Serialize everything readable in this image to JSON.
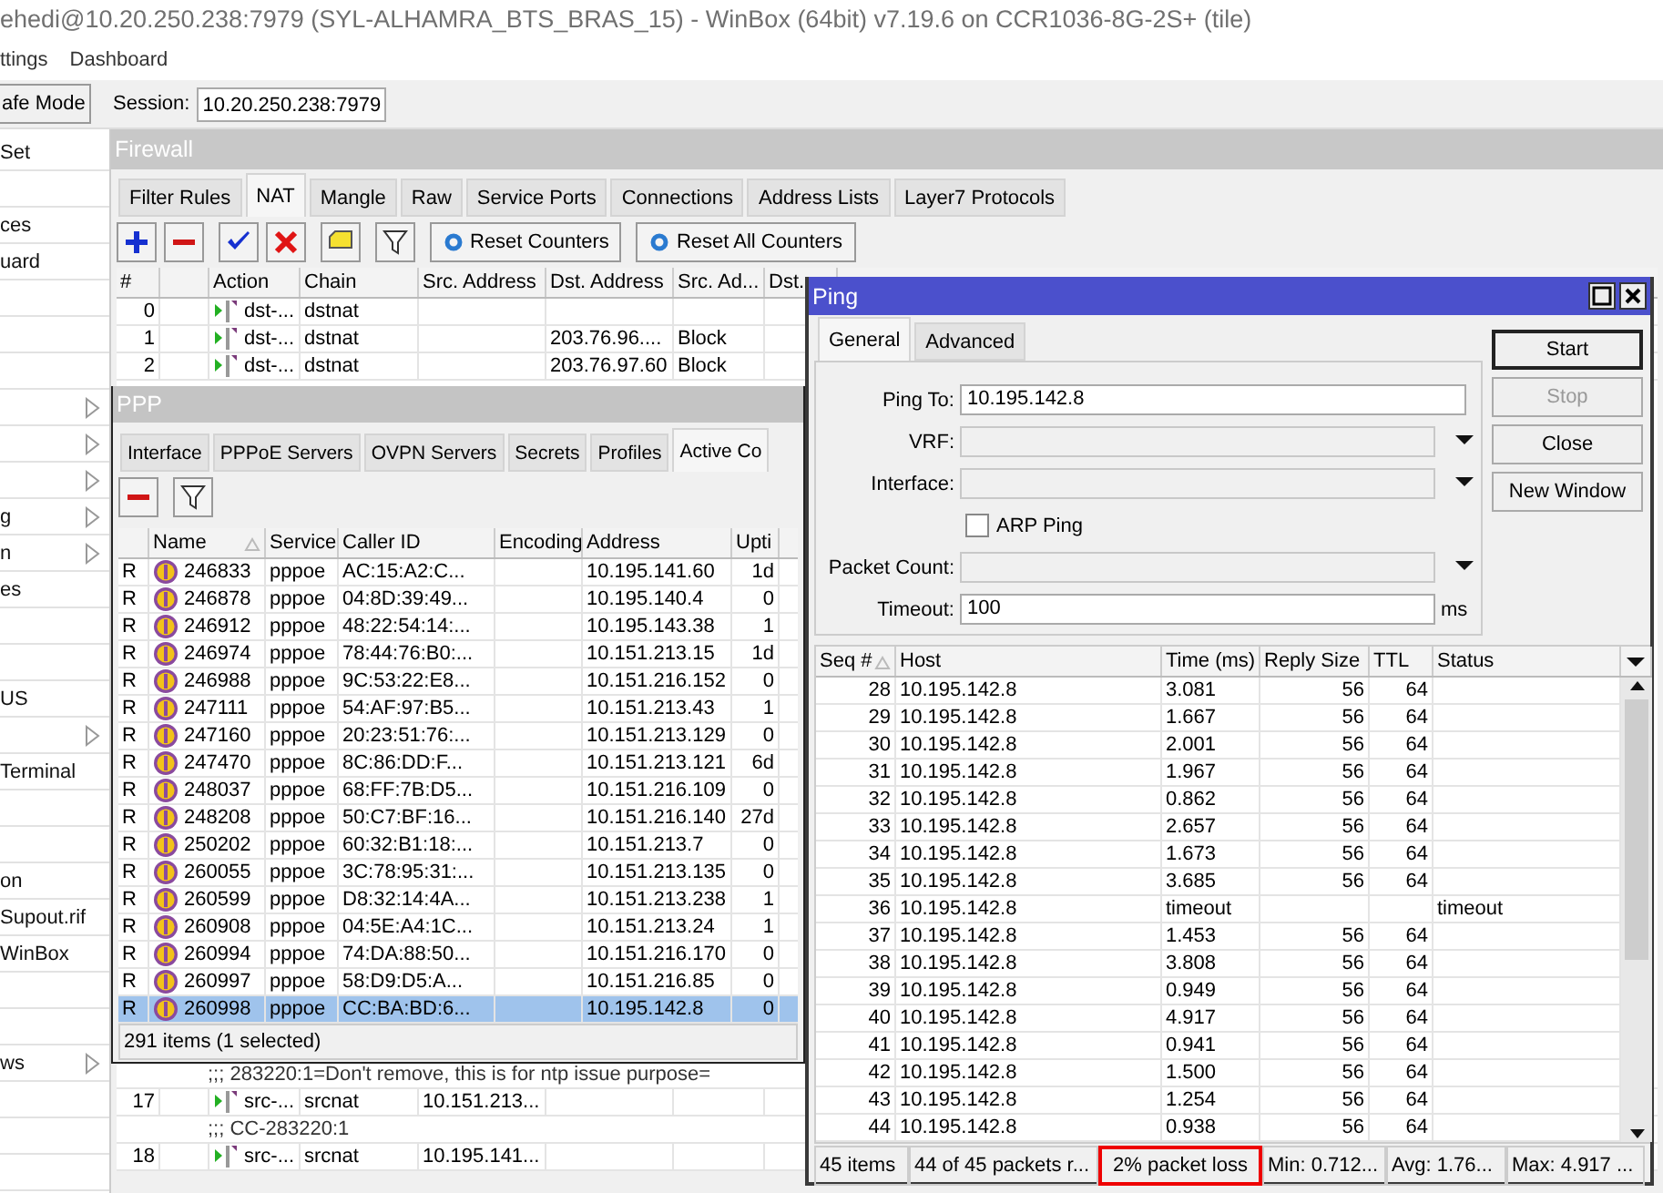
{
  "window": {
    "title": "ehedi@10.20.250.238:7979 (SYL-ALHAMRA_BTS_BRAS_15) - WinBox (64bit) v7.19.6 on CCR1036-8G-2S+ (tile)"
  },
  "menu": [
    "ttings",
    "Dashboard"
  ],
  "toolbar": {
    "safe_mode": "afe Mode",
    "session_label": "Session:",
    "session": "10.20.250.238:7979"
  },
  "sidebar": {
    "items": [
      {
        "label": "Set",
        "submenu": false
      },
      {
        "submenu": false
      },
      {
        "label": "ces",
        "submenu": false
      },
      {
        "label": "uard",
        "submenu": false
      },
      {
        "submenu": false
      },
      {
        "submenu": false
      },
      {
        "submenu": false
      },
      {
        "submenu": true
      },
      {
        "submenu": true
      },
      {
        "submenu": true
      },
      {
        "label": "g",
        "submenu": true
      },
      {
        "label": "n",
        "submenu": true
      },
      {
        "label": "es",
        "submenu": false
      },
      {
        "submenu": false
      },
      {
        "submenu": false
      },
      {
        "label": "US",
        "submenu": false
      },
      {
        "submenu": true
      },
      {
        "label": "Terminal",
        "submenu": false
      },
      {
        "submenu": false
      },
      {
        "submenu": false
      },
      {
        "label": "on",
        "submenu": false
      },
      {
        "label": "Supout.rif",
        "submenu": false
      },
      {
        "label": "WinBox",
        "submenu": false
      },
      {
        "submenu": false
      },
      {
        "submenu": false
      },
      {
        "label": "ws",
        "submenu": true
      },
      {
        "submenu": false
      },
      {
        "submenu": false
      },
      {
        "submenu": false
      }
    ]
  },
  "firewall": {
    "title": "Firewall",
    "tabs": [
      {
        "label": "Filter Rules",
        "selected": false
      },
      {
        "label": "NAT",
        "selected": true
      },
      {
        "label": "Mangle",
        "selected": false
      },
      {
        "label": "Raw",
        "selected": false
      },
      {
        "label": "Service Ports",
        "selected": false
      },
      {
        "label": "Connections",
        "selected": false
      },
      {
        "label": "Address Lists",
        "selected": false
      },
      {
        "label": "Layer7 Protocols",
        "selected": false
      }
    ],
    "buttons": [
      "Reset Counters",
      "Reset All Counters"
    ],
    "columns": [
      "#",
      "Action",
      "Chain",
      "Src. Address",
      "Dst. Address",
      "Src. Ad...",
      "Dst."
    ],
    "rows_top": [
      {
        "kind": "rule",
        "number": "0",
        "action": "dst-...",
        "chain": "dstnat"
      },
      {
        "kind": "rule",
        "number": "1",
        "action": "dst-...",
        "chain": "dstnat",
        "dst_address": "203.76.96....",
        "src_address_list": "Block"
      },
      {
        "kind": "rule",
        "number": "2",
        "action": "dst-...",
        "chain": "dstnat",
        "dst_address": "203.76.97.60",
        "src_address_list": "Block"
      }
    ],
    "rows_bottom": [
      {
        "kind": "comment",
        "text": ";;; 283220:1=Don't remove, this is for ntp issue purpose="
      },
      {
        "kind": "rule",
        "number": "17",
        "action": "src-...",
        "chain": "srcnat",
        "src_address": "10.151.213..."
      },
      {
        "kind": "comment",
        "text": ";;; CC-283220:1"
      },
      {
        "kind": "rule",
        "number": "18",
        "action": "src-...",
        "chain": "srcnat",
        "src_address": "10.195.141..."
      }
    ]
  },
  "ppp": {
    "title": "PPP",
    "tabs": [
      {
        "label": "Interface",
        "selected": false
      },
      {
        "label": "PPPoE Servers",
        "selected": false
      },
      {
        "label": "OVPN Servers",
        "selected": false
      },
      {
        "label": "Secrets",
        "selected": false
      },
      {
        "label": "Profiles",
        "selected": false
      },
      {
        "label": "Active Co",
        "selected": true
      }
    ],
    "columns": [
      "Name",
      "Service",
      "Caller ID",
      "Encoding",
      "Address",
      "Upti"
    ],
    "rows": [
      {
        "flag": "R",
        "name": "246833",
        "service": "pppoe",
        "caller_id": "AC:15:A2:C...",
        "address": "10.195.141.60",
        "uptime": "1d",
        "selected": false
      },
      {
        "flag": "R",
        "name": "246878",
        "service": "pppoe",
        "caller_id": "04:8D:39:49...",
        "address": "10.195.140.4",
        "uptime": "0",
        "selected": false
      },
      {
        "flag": "R",
        "name": "246912",
        "service": "pppoe",
        "caller_id": "48:22:54:14:...",
        "address": "10.195.143.38",
        "uptime": "1",
        "selected": false
      },
      {
        "flag": "R",
        "name": "246974",
        "service": "pppoe",
        "caller_id": "78:44:76:B0:...",
        "address": "10.151.213.15",
        "uptime": "1d",
        "selected": false
      },
      {
        "flag": "R",
        "name": "246988",
        "service": "pppoe",
        "caller_id": "9C:53:22:E8...",
        "address": "10.151.216.152",
        "uptime": "0",
        "selected": false
      },
      {
        "flag": "R",
        "name": "247111",
        "service": "pppoe",
        "caller_id": "54:AF:97:B5...",
        "address": "10.151.213.43",
        "uptime": "1",
        "selected": false
      },
      {
        "flag": "R",
        "name": "247160",
        "service": "pppoe",
        "caller_id": "20:23:51:76:...",
        "address": "10.151.213.129",
        "uptime": "0",
        "selected": false
      },
      {
        "flag": "R",
        "name": "247470",
        "service": "pppoe",
        "caller_id": "8C:86:DD:F...",
        "address": "10.151.213.121",
        "uptime": "6d",
        "selected": false
      },
      {
        "flag": "R",
        "name": "248037",
        "service": "pppoe",
        "caller_id": "68:FF:7B:D5...",
        "address": "10.151.216.109",
        "uptime": "0",
        "selected": false
      },
      {
        "flag": "R",
        "name": "248208",
        "service": "pppoe",
        "caller_id": "50:C7:BF:16...",
        "address": "10.151.216.140",
        "uptime": "27d",
        "selected": false
      },
      {
        "flag": "R",
        "name": "250202",
        "service": "pppoe",
        "caller_id": "60:32:B1:18:...",
        "address": "10.151.213.7",
        "uptime": "0",
        "selected": false
      },
      {
        "flag": "R",
        "name": "260055",
        "service": "pppoe",
        "caller_id": "3C:78:95:31:...",
        "address": "10.151.213.135",
        "uptime": "0",
        "selected": false
      },
      {
        "flag": "R",
        "name": "260599",
        "service": "pppoe",
        "caller_id": "D8:32:14:4A...",
        "address": "10.151.213.238",
        "uptime": "1",
        "selected": false
      },
      {
        "flag": "R",
        "name": "260908",
        "service": "pppoe",
        "caller_id": "04:5E:A4:1C...",
        "address": "10.151.213.24",
        "uptime": "1",
        "selected": false
      },
      {
        "flag": "R",
        "name": "260994",
        "service": "pppoe",
        "caller_id": "74:DA:88:50...",
        "address": "10.151.216.170",
        "uptime": "0",
        "selected": false
      },
      {
        "flag": "R",
        "name": "260997",
        "service": "pppoe",
        "caller_id": "58:D9:D5:A...",
        "address": "10.151.216.85",
        "uptime": "0",
        "selected": false
      },
      {
        "flag": "R",
        "name": "260998",
        "service": "pppoe",
        "caller_id": "CC:BA:BD:6...",
        "address": "10.195.142.8",
        "uptime": "0",
        "selected": true
      }
    ],
    "status": "291 items (1 selected)"
  },
  "ping": {
    "title": "Ping",
    "tabs": [
      {
        "label": "General",
        "selected": true
      },
      {
        "label": "Advanced",
        "selected": false
      }
    ],
    "fields": [
      {
        "kind": "text",
        "label": "Ping To:",
        "value": "10.195.142.8"
      },
      {
        "kind": "select",
        "label": "VRF:",
        "disabled": true
      },
      {
        "kind": "select",
        "label": "Interface:",
        "disabled": true
      },
      {
        "kind": "checkbox",
        "label": "ARP Ping",
        "checked": false
      },
      {
        "kind": "select",
        "label": "Packet Count:",
        "disabled": true
      },
      {
        "kind": "unit",
        "label": "Timeout:",
        "value": "100",
        "unit": "ms"
      }
    ],
    "buttons": [
      {
        "label": "Start",
        "default": true,
        "disabled": false
      },
      {
        "label": "Stop",
        "default": false,
        "disabled": true
      },
      {
        "label": "Close",
        "default": false,
        "disabled": false
      },
      {
        "label": "New Window",
        "default": false,
        "disabled": false
      }
    ],
    "columns": [
      "Seq #",
      "Host",
      "Time (ms)",
      "Reply Size",
      "TTL",
      "Status"
    ],
    "rows": [
      {
        "seq": "28",
        "host": "10.195.142.8",
        "time": "3.081",
        "reply_size": "56",
        "ttl": "64"
      },
      {
        "seq": "29",
        "host": "10.195.142.8",
        "time": "1.667",
        "reply_size": "56",
        "ttl": "64"
      },
      {
        "seq": "30",
        "host": "10.195.142.8",
        "time": "2.001",
        "reply_size": "56",
        "ttl": "64"
      },
      {
        "seq": "31",
        "host": "10.195.142.8",
        "time": "1.967",
        "reply_size": "56",
        "ttl": "64"
      },
      {
        "seq": "32",
        "host": "10.195.142.8",
        "time": "0.862",
        "reply_size": "56",
        "ttl": "64"
      },
      {
        "seq": "33",
        "host": "10.195.142.8",
        "time": "2.657",
        "reply_size": "56",
        "ttl": "64"
      },
      {
        "seq": "34",
        "host": "10.195.142.8",
        "time": "1.673",
        "reply_size": "56",
        "ttl": "64"
      },
      {
        "seq": "35",
        "host": "10.195.142.8",
        "time": "3.685",
        "reply_size": "56",
        "ttl": "64"
      },
      {
        "seq": "36",
        "host": "10.195.142.8",
        "time": "timeout",
        "status": "timeout"
      },
      {
        "seq": "37",
        "host": "10.195.142.8",
        "time": "1.453",
        "reply_size": "56",
        "ttl": "64"
      },
      {
        "seq": "38",
        "host": "10.195.142.8",
        "time": "3.808",
        "reply_size": "56",
        "ttl": "64"
      },
      {
        "seq": "39",
        "host": "10.195.142.8",
        "time": "0.949",
        "reply_size": "56",
        "ttl": "64"
      },
      {
        "seq": "40",
        "host": "10.195.142.8",
        "time": "4.917",
        "reply_size": "56",
        "ttl": "64"
      },
      {
        "seq": "41",
        "host": "10.195.142.8",
        "time": "0.941",
        "reply_size": "56",
        "ttl": "64"
      },
      {
        "seq": "42",
        "host": "10.195.142.8",
        "time": "1.500",
        "reply_size": "56",
        "ttl": "64"
      },
      {
        "seq": "43",
        "host": "10.195.142.8",
        "time": "1.254",
        "reply_size": "56",
        "ttl": "64"
      },
      {
        "seq": "44",
        "host": "10.195.142.8",
        "time": "0.938",
        "reply_size": "56",
        "ttl": "64"
      }
    ],
    "status": [
      {
        "text": "45 items",
        "highlighted": false
      },
      {
        "text": "44 of 45 packets r...",
        "highlighted": false
      },
      {
        "text": "2% packet loss",
        "highlighted": true
      },
      {
        "text": "Min: 0.712...",
        "highlighted": false
      },
      {
        "text": "Avg: 1.76...",
        "highlighted": false
      },
      {
        "text": "Max: 4.917 ...",
        "highlighted": false
      }
    ]
  }
}
